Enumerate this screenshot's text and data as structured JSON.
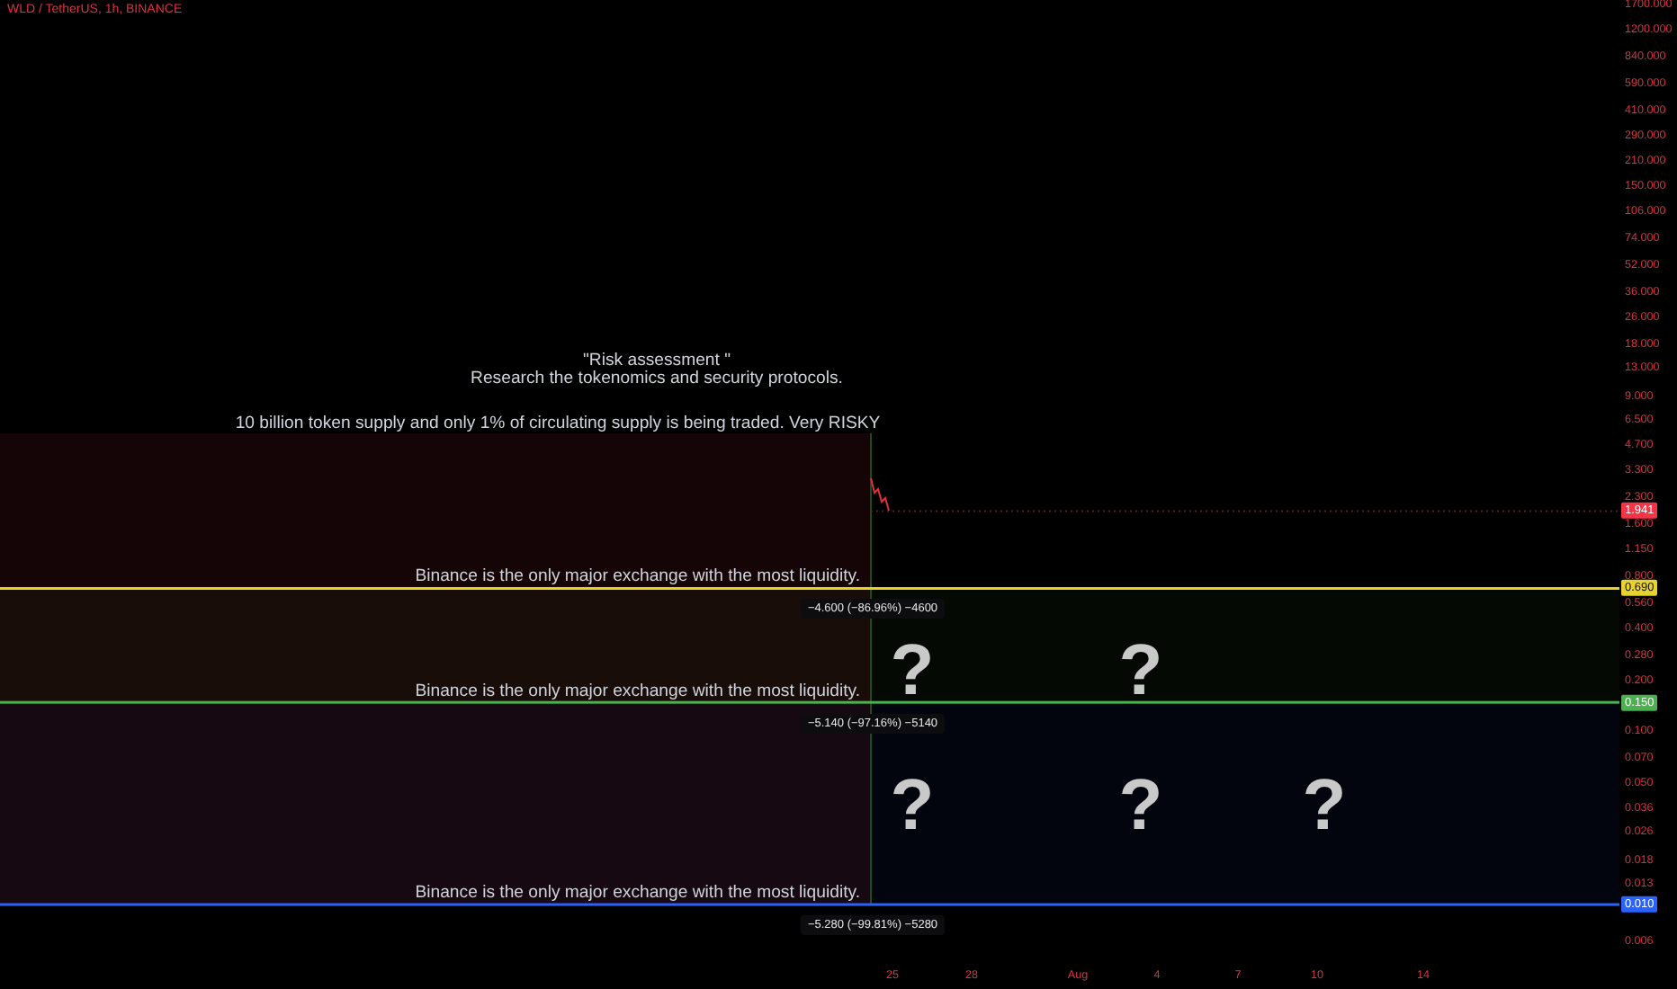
{
  "title": "WLD / TetherUS, 1h, BINANCE",
  "notes": [
    "\"Risk assessment \"",
    "Research the tokenomics and security protocols.",
    "10 billion token supply and only 1% of circulating supply is being traded. Very RISKY"
  ],
  "price_axis": {
    "ticks": [
      "1700.000",
      "1200.000",
      "840.000",
      "590.000",
      "410.000",
      "290.000",
      "210.000",
      "150.000",
      "106.000",
      "74.000",
      "52.000",
      "36.000",
      "26.000",
      "18.000",
      "13.000",
      "9.000",
      "6.500",
      "4.700",
      "3.300",
      "2.300",
      "1.600",
      "1.150",
      "0.800",
      "0.560",
      "0.400",
      "0.280",
      "0.200",
      "0.100",
      "0.070",
      "0.050",
      "0.036",
      "0.026",
      "0.018",
      "0.013",
      "0.006"
    ],
    "last_price": {
      "label": "1.941",
      "color": "#f23645"
    }
  },
  "levels": [
    {
      "label": "0.690",
      "color": "#e8d22f",
      "note": "Binance is the only major exchange with the most liquidity.",
      "measure": "−4.600 (−86.96%) −4600"
    },
    {
      "label": "0.150",
      "color": "#4caf50",
      "note": "Binance is the only major exchange with the most liquidity.",
      "measure": "−5.140 (−97.16%) −5140"
    },
    {
      "label": "0.010",
      "color": "#2962ff",
      "note": "Binance is the only major exchange with the most liquidity.",
      "measure": "−5.280 (−99.81%) −5280"
    }
  ],
  "question_marks": [
    "?",
    "?",
    "?",
    "?",
    "?"
  ],
  "time_axis": [
    "25",
    "28",
    "Aug",
    "4",
    "7",
    "10",
    "14"
  ]
}
